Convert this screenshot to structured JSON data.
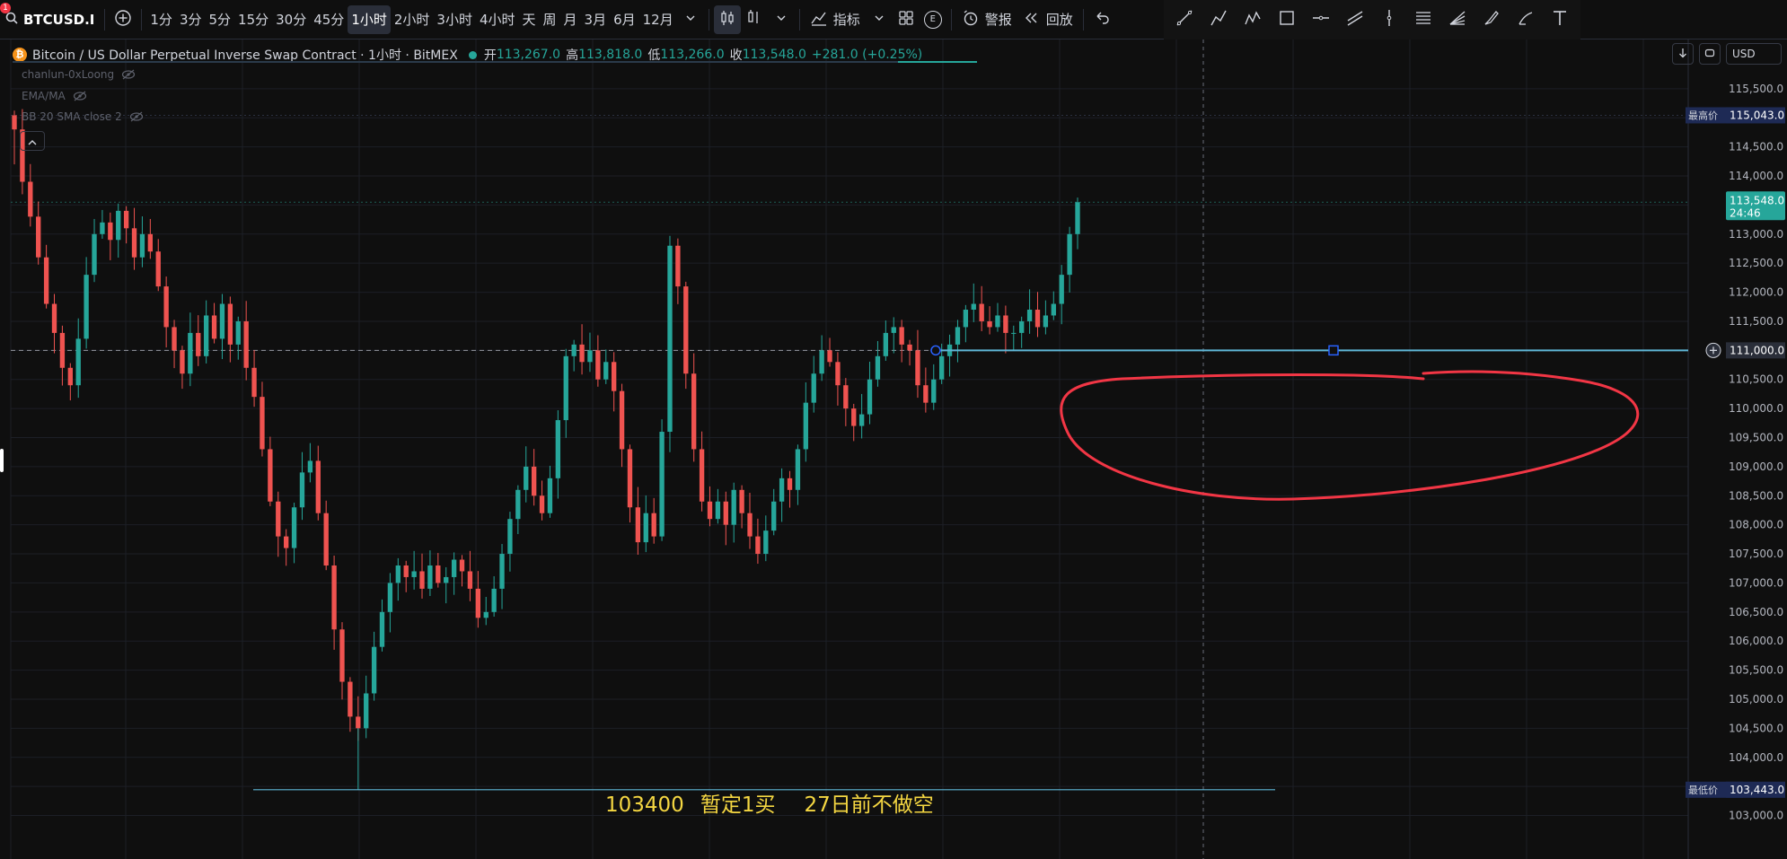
{
  "toolbar": {
    "symbol": "BTCUSD.I",
    "badge": "1",
    "timeframes": [
      "1分",
      "3分",
      "5分",
      "15分",
      "30分",
      "45分",
      "1小时",
      "2小时",
      "3小时",
      "4小时",
      "天",
      "周",
      "月",
      "3月",
      "6月",
      "12月"
    ],
    "active_timeframe": "1小时",
    "indicators_label": "指标",
    "alert_label": "警报",
    "replay_label": "回放",
    "e_badge": "E"
  },
  "legend": {
    "title": "Bitcoin / US Dollar Perpetual Inverse Swap Contract · 1小时 · BitMEX",
    "open_label": "开",
    "open": "113,267.0",
    "high_label": "高",
    "high": "113,818.0",
    "low_label": "低",
    "low": "113,266.0",
    "close_label": "收",
    "close": "113,548.0",
    "change": "+281.0 (+0.25%)"
  },
  "indicators": [
    "chanlun-0xLoong",
    "EMA/MA",
    "BB 20 SMA close 2"
  ],
  "currency": "USD",
  "price_axis": {
    "ticks": [
      "115,500.0",
      "115,000.0",
      "114,500.0",
      "114,000.0",
      "113,500.0",
      "113,000.0",
      "112,500.0",
      "112,000.0",
      "111,500.0",
      "111,000.0",
      "110,500.0",
      "110,000.0",
      "109,500.0",
      "109,000.0",
      "108,500.0",
      "108,000.0",
      "107,500.0",
      "107,000.0",
      "106,500.0",
      "106,000.0",
      "105,500.0",
      "105,000.0",
      "104,500.0",
      "104,000.0",
      "103,500.0",
      "103,000.0"
    ],
    "high_tag_label": "最高价",
    "high_tag_value": "115,043.0",
    "current_price": "113,548.0",
    "countdown": "24:46",
    "line_value": "111,000.0",
    "low_tag_label": "最低价",
    "low_tag_value": "103,443.0"
  },
  "annotation": [
    "103400",
    "暂定1买",
    "27日前不做空"
  ],
  "colors": {
    "up": "#26a69a",
    "down": "#ef5350",
    "drawing_line": "#5fb6d6",
    "ellipse": "#f23645",
    "annotation": "#f5d742"
  },
  "chart_data": {
    "type": "candlestick",
    "ylim": [
      102900,
      116100
    ],
    "high": 115043,
    "low": 103443,
    "horizontal_line": 111000,
    "low_line": 103443,
    "close_series": [
      114800,
      113900,
      113300,
      112600,
      111800,
      111300,
      110700,
      110400,
      111200,
      112300,
      113000,
      113200,
      112900,
      113400,
      113100,
      112600,
      113000,
      112700,
      112100,
      111400,
      111000,
      110600,
      111300,
      110900,
      111600,
      111200,
      111800,
      111100,
      111500,
      110700,
      110200,
      109300,
      108400,
      107800,
      107600,
      108300,
      108900,
      109100,
      108200,
      107300,
      106200,
      105300,
      104700,
      104500,
      105100,
      105900,
      106500,
      107000,
      107300,
      107100,
      107200,
      106900,
      107300,
      107000,
      107100,
      107400,
      107200,
      106900,
      106400,
      106500,
      106900,
      107500,
      108100,
      108600,
      109000,
      108500,
      108200,
      108800,
      109800,
      110900,
      111100,
      110800,
      111000,
      110500,
      110800,
      110300,
      109300,
      108300,
      107700,
      108200,
      107800,
      109600,
      112800,
      112100,
      110600,
      109300,
      108400,
      108100,
      108400,
      108000,
      108600,
      108200,
      107800,
      107500,
      107900,
      108400,
      108800,
      108600,
      109300,
      110100,
      110600,
      111000,
      110800,
      110400,
      110000,
      109700,
      109900,
      110500,
      110900,
      111300,
      111400,
      111100,
      111000,
      110400,
      110100,
      110500,
      110900,
      111100,
      111400,
      111700,
      111800,
      111500,
      111400,
      111600,
      111300,
      111300,
      111500,
      111700,
      111400,
      111600,
      111800,
      112300,
      113000,
      113548
    ]
  }
}
